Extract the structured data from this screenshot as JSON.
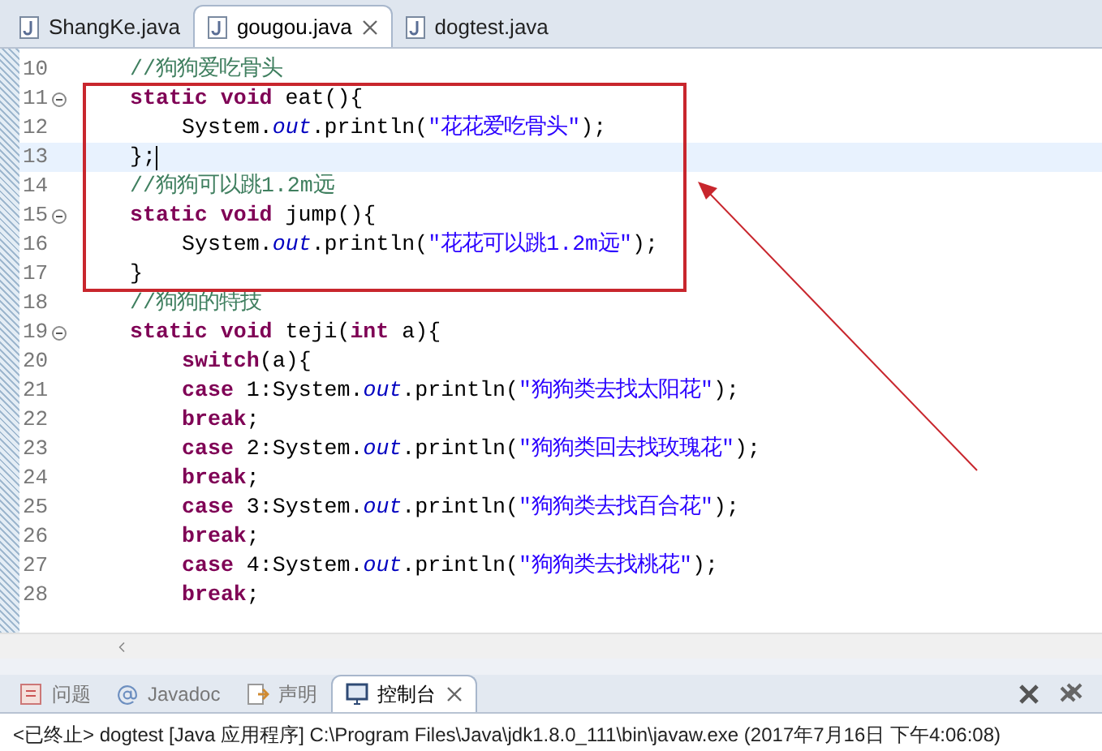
{
  "editor_tabs": [
    {
      "label": "ShangKe.java",
      "selected": false,
      "closable": false
    },
    {
      "label": "gougou.java",
      "selected": true,
      "closable": true
    },
    {
      "label": "dogtest.java",
      "selected": false,
      "closable": false
    }
  ],
  "code_lines": [
    {
      "number": "10",
      "current": false,
      "foldable": false,
      "tokens": [
        {
          "kind": "comment",
          "text": "//狗狗爱吃骨头"
        }
      ]
    },
    {
      "number": "11",
      "current": false,
      "foldable": true,
      "tokens": [
        {
          "kind": "keyword",
          "text": "static"
        },
        {
          "kind": "keyword",
          "text": " void"
        },
        {
          "kind": "plain",
          "text": " eat(){"
        }
      ],
      "children": [
        {
          "number": "12",
          "current": false,
          "foldable": false,
          "tokens": [
            {
              "kind": "plain",
              "text": "System."
            },
            {
              "kind": "field",
              "text": "out"
            },
            {
              "kind": "plain",
              "text": ".println("
            },
            {
              "kind": "string",
              "text": "\"花花爱吃骨头\""
            },
            {
              "kind": "plain",
              "text": ");"
            }
          ]
        }
      ]
    },
    {
      "number": "13",
      "current": true,
      "foldable": false,
      "tokens": [
        {
          "kind": "plain",
          "text": "};"
        }
      ]
    },
    {
      "number": "14",
      "current": false,
      "foldable": false,
      "tokens": [
        {
          "kind": "comment",
          "text": "//狗狗可以跳1.2m远"
        }
      ]
    },
    {
      "number": "15",
      "current": false,
      "foldable": true,
      "tokens": [
        {
          "kind": "keyword",
          "text": "static"
        },
        {
          "kind": "keyword",
          "text": " void"
        },
        {
          "kind": "plain",
          "text": " jump(){"
        }
      ],
      "children": [
        {
          "number": "16",
          "current": false,
          "foldable": false,
          "tokens": [
            {
              "kind": "plain",
              "text": "System."
            },
            {
              "kind": "field",
              "text": "out"
            },
            {
              "kind": "plain",
              "text": ".println("
            },
            {
              "kind": "string",
              "text": "\"花花可以跳1.2m远\""
            },
            {
              "kind": "plain",
              "text": ");"
            }
          ]
        }
      ]
    },
    {
      "number": "17",
      "current": false,
      "foldable": false,
      "tokens": [
        {
          "kind": "plain",
          "text": "}"
        }
      ]
    },
    {
      "number": "18",
      "current": false,
      "foldable": false,
      "tokens": [
        {
          "kind": "comment",
          "text": "//狗狗的特技"
        }
      ]
    },
    {
      "number": "19",
      "current": false,
      "foldable": true,
      "tokens": [
        {
          "kind": "keyword",
          "text": "static"
        },
        {
          "kind": "keyword",
          "text": " void"
        },
        {
          "kind": "plain",
          "text": " teji("
        },
        {
          "kind": "keyword",
          "text": "int"
        },
        {
          "kind": "plain",
          "text": " a){"
        }
      ],
      "children": [
        {
          "number": "20",
          "current": false,
          "foldable": false,
          "tokens": [
            {
              "kind": "keyword",
              "text": "switch"
            },
            {
              "kind": "plain",
              "text": "(a){"
            }
          ]
        },
        {
          "number": "21",
          "current": false,
          "foldable": false,
          "tokens": [
            {
              "kind": "keyword",
              "text": "case"
            },
            {
              "kind": "plain",
              "text": " 1:System."
            },
            {
              "kind": "field",
              "text": "out"
            },
            {
              "kind": "plain",
              "text": ".println("
            },
            {
              "kind": "string",
              "text": "\"狗狗类去找太阳花\""
            },
            {
              "kind": "plain",
              "text": ");"
            }
          ]
        },
        {
          "number": "22",
          "current": false,
          "foldable": false,
          "tokens": [
            {
              "kind": "keyword",
              "text": "break"
            },
            {
              "kind": "plain",
              "text": ";"
            }
          ]
        },
        {
          "number": "23",
          "current": false,
          "foldable": false,
          "tokens": [
            {
              "kind": "keyword",
              "text": "case"
            },
            {
              "kind": "plain",
              "text": " 2:System."
            },
            {
              "kind": "field",
              "text": "out"
            },
            {
              "kind": "plain",
              "text": ".println("
            },
            {
              "kind": "string",
              "text": "\"狗狗类回去找玫瑰花\""
            },
            {
              "kind": "plain",
              "text": ");"
            }
          ]
        },
        {
          "number": "24",
          "current": false,
          "foldable": false,
          "tokens": [
            {
              "kind": "keyword",
              "text": "break"
            },
            {
              "kind": "plain",
              "text": ";"
            }
          ]
        },
        {
          "number": "25",
          "current": false,
          "foldable": false,
          "tokens": [
            {
              "kind": "keyword",
              "text": "case"
            },
            {
              "kind": "plain",
              "text": " 3:System."
            },
            {
              "kind": "field",
              "text": "out"
            },
            {
              "kind": "plain",
              "text": ".println("
            },
            {
              "kind": "string",
              "text": "\"狗狗类去找百合花\""
            },
            {
              "kind": "plain",
              "text": ");"
            }
          ]
        },
        {
          "number": "26",
          "current": false,
          "foldable": false,
          "tokens": [
            {
              "kind": "keyword",
              "text": "break"
            },
            {
              "kind": "plain",
              "text": ";"
            }
          ]
        },
        {
          "number": "27",
          "current": false,
          "foldable": false,
          "tokens": [
            {
              "kind": "keyword",
              "text": "case"
            },
            {
              "kind": "plain",
              "text": " 4:System."
            },
            {
              "kind": "field",
              "text": "out"
            },
            {
              "kind": "plain",
              "text": ".println("
            },
            {
              "kind": "string",
              "text": "\"狗狗类去找桃花\""
            },
            {
              "kind": "plain",
              "text": ");"
            }
          ]
        },
        {
          "number": "28",
          "current": false,
          "foldable": false,
          "tokens": [
            {
              "kind": "keyword",
              "text": "break"
            },
            {
              "kind": "plain",
              "text": ";"
            }
          ]
        }
      ]
    }
  ],
  "panel_tabs": [
    {
      "label": "问题",
      "kind": "problems",
      "selected": false,
      "closable": false
    },
    {
      "label": "Javadoc",
      "kind": "javadoc",
      "selected": false,
      "closable": false
    },
    {
      "label": "声明",
      "kind": "declaration",
      "selected": false,
      "closable": false
    },
    {
      "label": "控制台",
      "kind": "console",
      "selected": true,
      "closable": true
    }
  ],
  "console": {
    "status": "<已终止> dogtest [Java 应用程序] C:\\Program Files\\Java\\jdk1.8.0_111\\bin\\javaw.exe (2017年7月16日 下午4:06:08)"
  }
}
